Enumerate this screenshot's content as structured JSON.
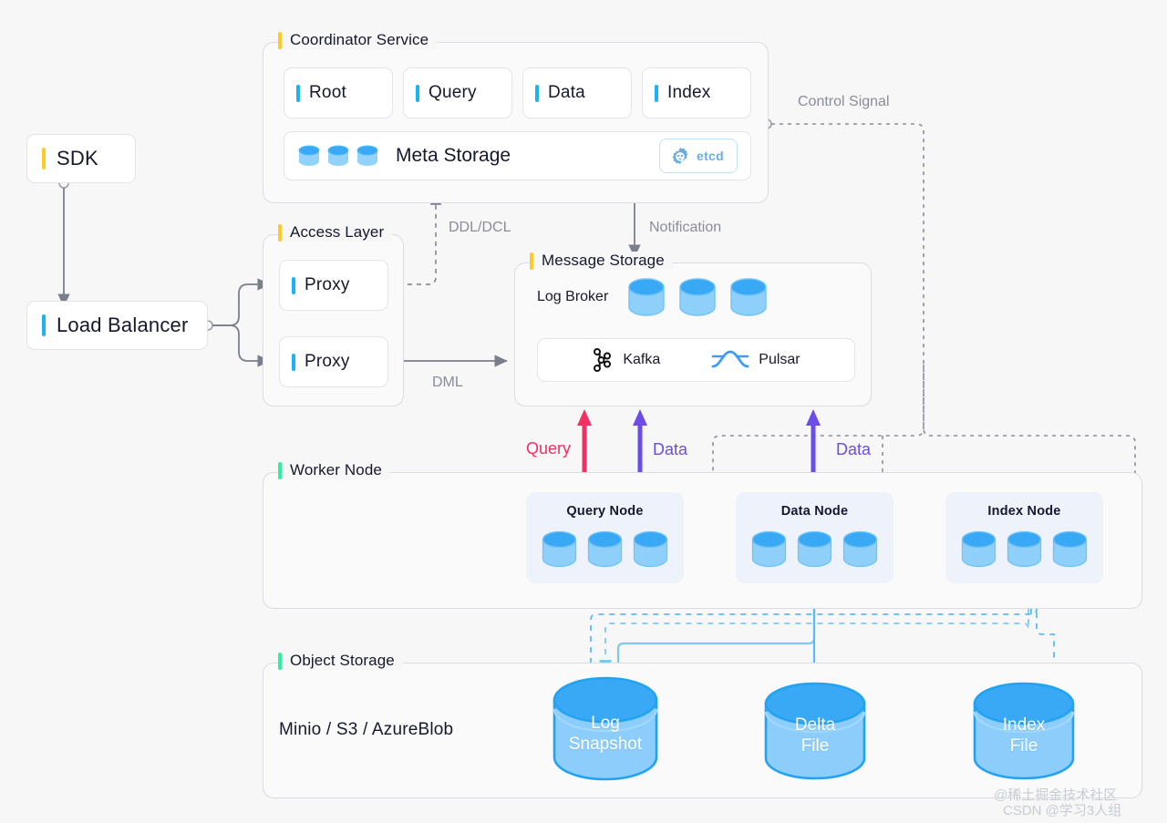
{
  "diagram": {
    "background": "#f7f7f8",
    "accent_yellow": "#ffc928",
    "accent_green": "#2ff0a0",
    "accent_blue": "#1ab4f5",
    "query_color": "#f42f63",
    "data_color": "#6b4de8",
    "object_color": "#35a9f6"
  },
  "sdk": {
    "label": "SDK"
  },
  "load_balancer": {
    "label": "Load Balancer"
  },
  "coordinator": {
    "title": "Coordinator Service",
    "nodes": [
      {
        "label": "Root"
      },
      {
        "label": "Query"
      },
      {
        "label": "Data"
      },
      {
        "label": "Index"
      }
    ],
    "meta_storage": {
      "label": "Meta Storage",
      "badge": "etcd",
      "badge_icon": "etcd-gear-icon",
      "cylinder_count": 3
    }
  },
  "access_layer": {
    "title": "Access Layer",
    "proxies": [
      {
        "label": "Proxy"
      },
      {
        "label": "Proxy"
      }
    ]
  },
  "message_storage": {
    "title": "Message Storage",
    "log_broker_label": "Log Broker",
    "cylinder_count": 3,
    "brokers": [
      {
        "name": "Kafka",
        "icon": "kafka-icon"
      },
      {
        "name": "Pulsar",
        "icon": "pulsar-icon"
      }
    ]
  },
  "worker_node": {
    "title": "Worker Node",
    "nodes": [
      {
        "label": "Query Node",
        "cylinder_count": 3
      },
      {
        "label": "Data Node",
        "cylinder_count": 3
      },
      {
        "label": "Index Node",
        "cylinder_count": 3
      }
    ]
  },
  "object_storage": {
    "title": "Object Storage",
    "providers": "Minio / S3 / AzureBlob",
    "files": [
      {
        "line1": "Log",
        "line2": "Snapshot"
      },
      {
        "line1": "Delta",
        "line2": "File"
      },
      {
        "line1": "Index",
        "line2": "File"
      }
    ]
  },
  "edge_labels": {
    "control_signal": "Control Signal",
    "ddl_dcl": "DDL/DCL",
    "notification": "Notification",
    "dml": "DML",
    "query": "Query",
    "data_left": "Data",
    "data_right": "Data"
  },
  "watermark": {
    "line1": "@稀土掘金技术社区",
    "line2": "CSDN @学习3人组"
  }
}
